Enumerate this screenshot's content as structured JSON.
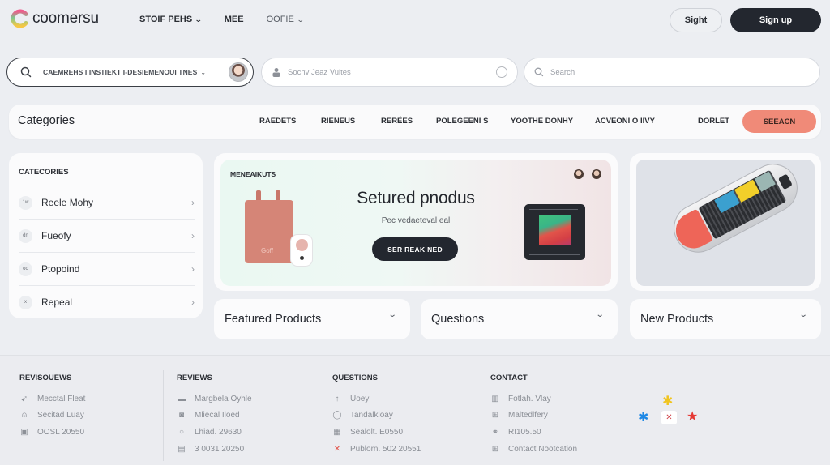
{
  "brand": {
    "name": "coomersu"
  },
  "topnav": {
    "links": [
      {
        "label": "STOIF PEHS",
        "has_dropdown": true
      },
      {
        "label": "MEE",
        "has_dropdown": false
      },
      {
        "label": "OOFIE",
        "has_dropdown": true
      }
    ],
    "sight_label": "Sight",
    "signup_label": "Sign up"
  },
  "search_row": {
    "primary": {
      "icon": "search-icon",
      "value": "CAEMREHS I INSTIEKT I-DESIEMENOUI TNES",
      "has_dropdown": true
    },
    "secondary": {
      "icon": "user-icon",
      "placeholder": "Sochv Jeaz Vultes",
      "right_icon": "chat-icon"
    },
    "tertiary": {
      "icon": "search-icon",
      "placeholder": "Search"
    }
  },
  "category_bar": {
    "title": "Categories",
    "links": [
      "RAEDETS",
      "RIENEUS",
      "RERÉES",
      "POLEGEENI S",
      "YOOTHE DONHY",
      "ACVEONI O IIVY",
      "DORLET"
    ],
    "search_label": "SEEACN",
    "accent": "#f08a78"
  },
  "sidebar": {
    "title": "CATECORIES",
    "items": [
      {
        "icon": "1w",
        "label": "Reele Mohy"
      },
      {
        "icon": "dn",
        "label": "Fueofy"
      },
      {
        "icon": "oo",
        "label": "Ptopoind"
      },
      {
        "icon": "x",
        "label": "Repeal"
      }
    ]
  },
  "hero": {
    "tag": "MENEAIKUTS",
    "title": "Setured pnodus",
    "subtitle": "Pec vedaeteval eal",
    "button_label": "SER REAK NED",
    "bag_brand": "Goff"
  },
  "tiles": [
    {
      "label": "Featured Products"
    },
    {
      "label": "Questions"
    },
    {
      "label": "New Products"
    }
  ],
  "footer": {
    "columns": [
      {
        "heading": "REVISOUEWS",
        "items": [
          {
            "icon": "thumb-icon",
            "label": "Mecctal Fleat"
          },
          {
            "icon": "person-icon",
            "label": "Secitad Luay"
          },
          {
            "icon": "card-icon",
            "label": "OOSL 20550"
          }
        ]
      },
      {
        "heading": "REVIEWS",
        "items": [
          {
            "icon": "chat-icon",
            "label": "Margbela Oyhle"
          },
          {
            "icon": "camera-icon",
            "label": "Mliecal Iloed"
          },
          {
            "icon": "bulb-icon",
            "label": "Lhiad. 29630"
          },
          {
            "icon": "calendar-icon",
            "label": "3 0031 20250"
          }
        ]
      },
      {
        "heading": "QUESTIONS",
        "items": [
          {
            "icon": "arrow-up-icon",
            "label": "Uoey"
          },
          {
            "icon": "circle-icon",
            "label": "Tandalkloay"
          },
          {
            "icon": "bus-icon",
            "label": "Sealolt. E0550"
          },
          {
            "icon": "x-icon",
            "label": "Publorn. 502 20551"
          }
        ]
      },
      {
        "heading": "CONTACT",
        "items": [
          {
            "icon": "id-icon",
            "label": "Fotlah. Vlay"
          },
          {
            "icon": "grid-icon",
            "label": "Maltedlfery"
          },
          {
            "icon": "link-icon",
            "label": "RI105.50"
          },
          {
            "icon": "grid-icon",
            "label": "Contact Nootcation"
          }
        ]
      }
    ],
    "social": [
      {
        "icon": "yellow-star-icon",
        "color": "#f0c420"
      },
      {
        "icon": "blue-star-icon",
        "color": "#1e88e5"
      },
      {
        "icon": "close-icon",
        "color": "#d0434a"
      },
      {
        "icon": "red-star-icon",
        "color": "#e53935"
      }
    ]
  }
}
